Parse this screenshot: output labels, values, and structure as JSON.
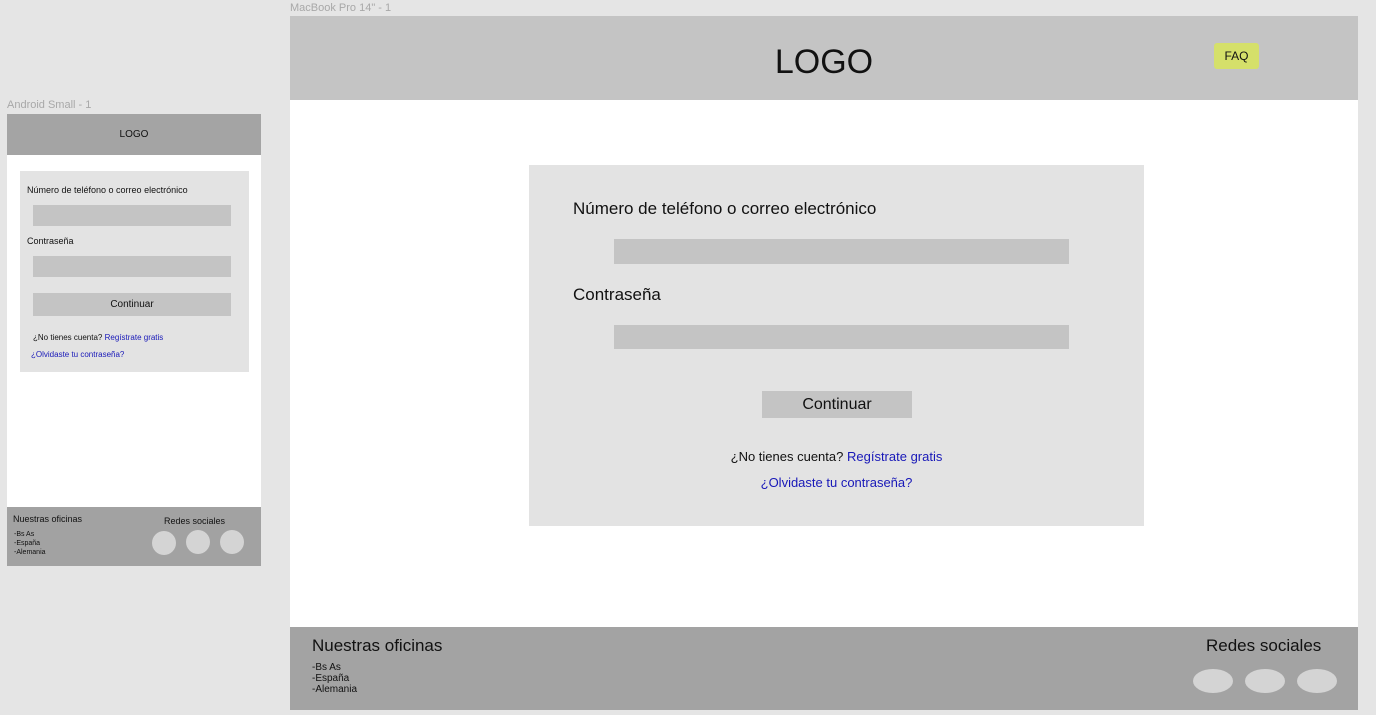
{
  "mobile": {
    "frame_label": "Android Small - 1",
    "logo": "LOGO",
    "login": {
      "identifier_label": "Número de teléfono o correo electrónico",
      "password_label": "Contraseña",
      "continue_label": "Continuar",
      "no_account_text": "¿No tienes cuenta?",
      "register_link": "Regístrate gratis",
      "forgot_link": "¿Olvidaste tu contraseña?"
    },
    "footer": {
      "offices_title": "Nuestras oficinas",
      "offices": [
        "-Bs As",
        "-España",
        "-Alemania"
      ],
      "social_title": "Redes sociales"
    }
  },
  "desktop": {
    "frame_label": "MacBook Pro 14\" - 1",
    "logo": "LOGO",
    "faq_label": "FAQ",
    "login": {
      "identifier_label": "Número de teléfono o correo electrónico",
      "password_label": "Contraseña",
      "continue_label": "Continuar",
      "no_account_text": "¿No tienes cuenta?",
      "register_link": "Regístrate gratis",
      "forgot_link": "¿Olvidaste tu contraseña?"
    },
    "footer": {
      "offices_title": "Nuestras oficinas",
      "offices": [
        "-Bs As",
        "-España",
        "-Alemania"
      ],
      "social_title": "Redes sociales"
    }
  },
  "colors": {
    "canvas": "#e5e5e5",
    "header": "#c4c4c4",
    "card": "#e3e3e3",
    "footer": "#a3a3a3",
    "faq": "#d5e06a",
    "link": "#1818b8"
  }
}
